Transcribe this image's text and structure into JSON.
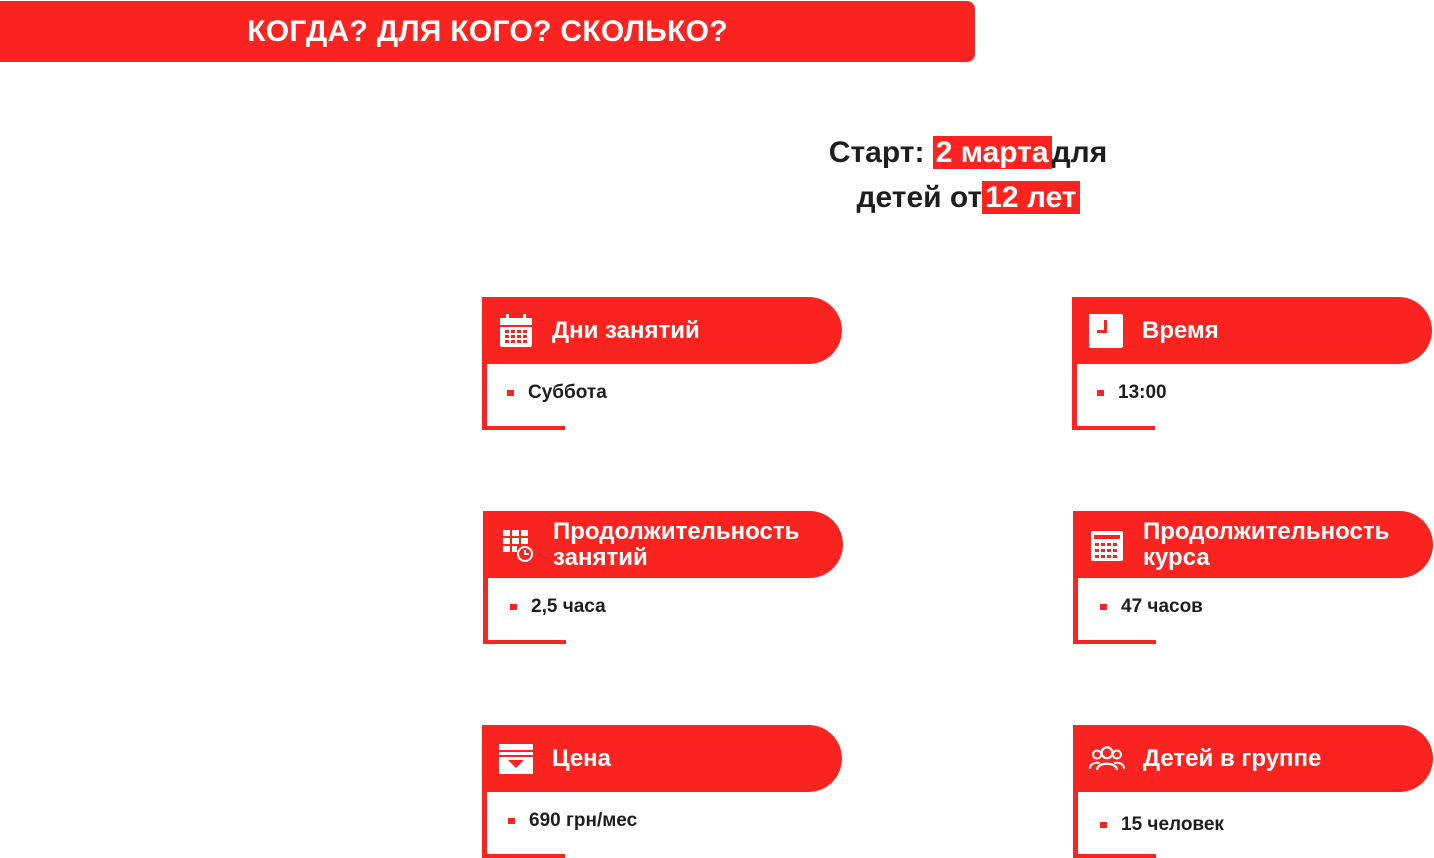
{
  "banner": {
    "title": "КОГДА? ДЛЯ КОГО? СКОЛЬКО?"
  },
  "start": {
    "prefix": "Старт:",
    "date": "2 марта",
    "middle": "для",
    "line2_prefix": "детей от",
    "age": "12 лет"
  },
  "colors": {
    "accent": "#f9241f",
    "text": "#1e1e1e"
  },
  "cards": {
    "days": {
      "title": "Дни занятий",
      "value": "Суббота",
      "icon": "calendar-icon"
    },
    "time": {
      "title": "Время",
      "value": "13:00",
      "icon": "clock-icon"
    },
    "lesson_duration": {
      "title": "Продолжительность занятий",
      "value": "2,5 часа",
      "icon": "schedule-icon"
    },
    "course_duration": {
      "title": "Продолжительность курса",
      "value": "47 часов",
      "icon": "calculator-icon"
    },
    "price": {
      "title": "Цена",
      "value": "690 грн/мес",
      "icon": "wallet-icon"
    },
    "group": {
      "title": "Детей в группе",
      "value": "15 человек",
      "icon": "group-icon"
    }
  }
}
